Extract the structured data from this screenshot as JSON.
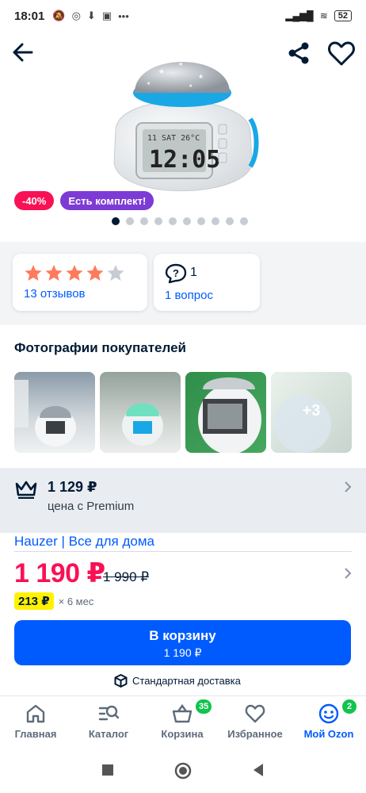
{
  "status_bar": {
    "time": "18:01",
    "icons": [
      "mute-icon",
      "whatsapp-icon",
      "download-icon",
      "app-icon",
      "more-icon"
    ],
    "battery": "52"
  },
  "product": {
    "discount_badge": "-40%",
    "kit_badge": "Есть комплект!",
    "gallery_count": 10,
    "gallery_active": 0
  },
  "reviews": {
    "rating": 4,
    "reviews_label": "13 отзывов",
    "questions_count": "1",
    "questions_label": "1 вопрос"
  },
  "customer_photos": {
    "title": "Фотографии покупателей",
    "more_label": "+3"
  },
  "premium": {
    "price": "1 129 ₽",
    "label": "цена с Premium"
  },
  "seller": {
    "name": "Hauzer | Все для дома"
  },
  "pricing": {
    "price": "1 190 ₽",
    "old_price": "1 990 ₽",
    "installment_amount": "213 ₽",
    "installment_term": "× 6 мес"
  },
  "cart_button": {
    "label": "В корзину",
    "price": "1 190 ₽"
  },
  "delivery": {
    "label": "Стандартная доставка"
  },
  "bottom_nav": {
    "items": [
      {
        "label": "Главная"
      },
      {
        "label": "Каталог"
      },
      {
        "label": "Корзина",
        "badge": "35"
      },
      {
        "label": "Избранное"
      },
      {
        "label": "Мой Ozon",
        "badge": "2"
      }
    ]
  },
  "colors": {
    "accent": "#005bff",
    "price": "#f91155",
    "badge_green": "#10c44c",
    "kit_badge": "#7d3bd6",
    "installment": "#fff200"
  }
}
